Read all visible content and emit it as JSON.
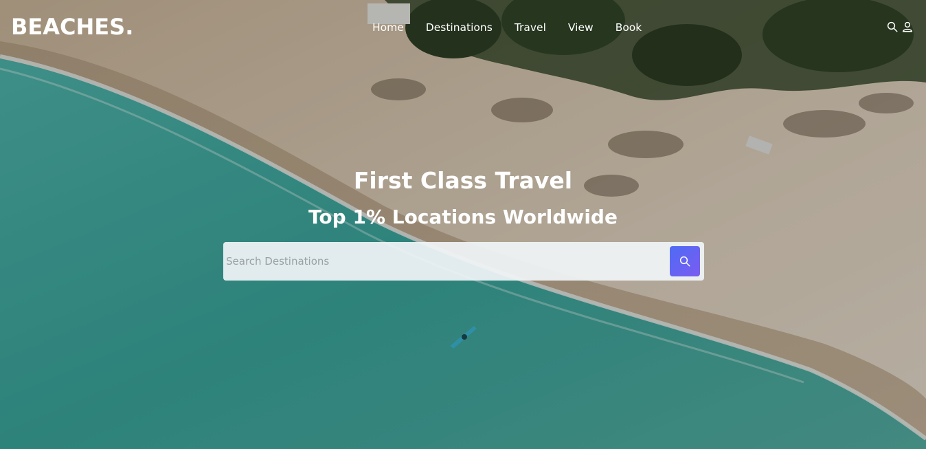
{
  "brand": {
    "logo_text": "BEACHES."
  },
  "nav": {
    "links": [
      {
        "label": "Home"
      },
      {
        "label": "Destinations"
      },
      {
        "label": "Travel"
      },
      {
        "label": "View"
      },
      {
        "label": "Book"
      }
    ],
    "icons": [
      "search-icon",
      "user-icon"
    ]
  },
  "hero": {
    "title": "First Class Travel",
    "subtitle": "Top 1% Locations Worldwide"
  },
  "search": {
    "placeholder": "Search Destinations",
    "value": "",
    "button_icon": "search-icon",
    "button_gradient": [
      "#4e6bf5",
      "#7b5cf0"
    ]
  },
  "colors": {
    "sea": "#3fa9a0",
    "sand": "#d8c6ad",
    "foliage": "#3a4b2e",
    "text": "#ffffff"
  }
}
